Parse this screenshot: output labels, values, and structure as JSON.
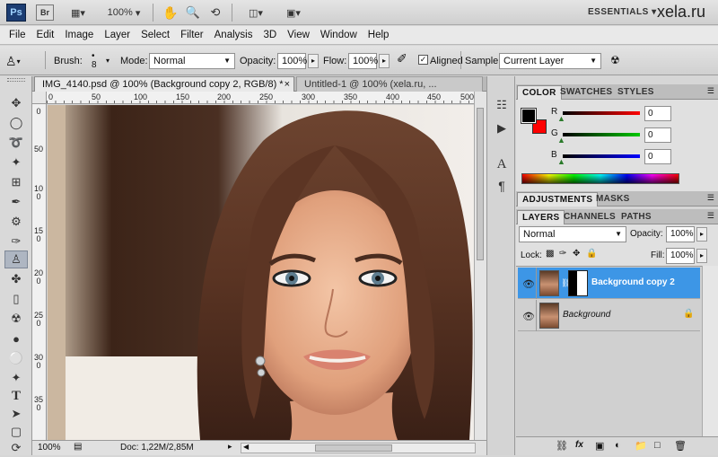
{
  "app": {
    "logo_ps": "Ps",
    "logo_br": "Br",
    "zoom": "100%",
    "workspace": "ESSENTIALS",
    "watermark": "xela.ru"
  },
  "menu": [
    "File",
    "Edit",
    "Image",
    "Layer",
    "Select",
    "Filter",
    "Analysis",
    "3D",
    "View",
    "Window",
    "Help"
  ],
  "options": {
    "brush_label": "Brush:",
    "brush_size": "8",
    "mode_label": "Mode:",
    "mode_value": "Normal",
    "opacity_label": "Opacity:",
    "opacity_value": "100%",
    "flow_label": "Flow:",
    "flow_value": "100%",
    "aligned_label": "Aligned",
    "sample_label": "Sample:",
    "sample_value": "Current Layer"
  },
  "tabs": [
    {
      "label": "IMG_4140.psd @ 100% (Background copy 2, RGB/8) *"
    },
    {
      "label": "Untitled-1 @ 100% (xela.ru, ..."
    }
  ],
  "ruler": {
    "h": [
      "0",
      "50",
      "100",
      "150",
      "200",
      "250",
      "300",
      "350",
      "400",
      "450",
      "500"
    ],
    "v": [
      "0",
      "50",
      "100",
      "150",
      "200",
      "250",
      "300",
      "350"
    ]
  },
  "status": {
    "zoom": "100%",
    "doc": "Doc: 1,22M/2,85M"
  },
  "color_panel": {
    "tabs": [
      "COLOR",
      "SWATCHES",
      "STYLES"
    ],
    "r_label": "R",
    "r_value": "0",
    "g_label": "G",
    "g_value": "0",
    "b_label": "B",
    "b_value": "0",
    "fg_color": "#000000",
    "bg_color": "#ff0000"
  },
  "adjust_panel": {
    "tabs": [
      "ADJUSTMENTS",
      "MASKS"
    ]
  },
  "layers_panel": {
    "tabs": [
      "LAYERS",
      "CHANNELS",
      "PATHS"
    ],
    "blend_mode": "Normal",
    "opacity_label": "Opacity:",
    "opacity_value": "100%",
    "lock_label": "Lock:",
    "fill_label": "Fill:",
    "fill_value": "100%",
    "layers": [
      {
        "name": "Background copy 2",
        "selected": true
      },
      {
        "name": "Background",
        "selected": false
      }
    ]
  }
}
